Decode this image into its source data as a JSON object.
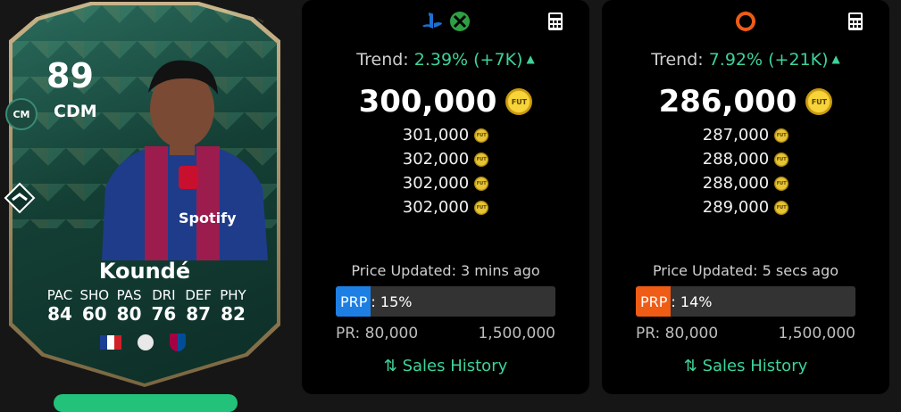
{
  "card": {
    "rating": "89",
    "position": "CDM",
    "alt_position": "CM",
    "name": "Koundé",
    "stats": [
      {
        "label": "PAC",
        "value": "84"
      },
      {
        "label": "SHO",
        "value": "60"
      },
      {
        "label": "PAS",
        "value": "80"
      },
      {
        "label": "DRI",
        "value": "76"
      },
      {
        "label": "DEF",
        "value": "87"
      },
      {
        "label": "PHY",
        "value": "82"
      }
    ],
    "icons": [
      "playstyle-icon",
      "france-flag-icon",
      "league-icon",
      "club-badge-icon"
    ]
  },
  "panels": [
    {
      "platforms": [
        "playstation-icon",
        "xbox-icon"
      ],
      "trend_label": "Trend:",
      "trend_value": "2.39% (+7K)",
      "main_price": "300,000",
      "coin_label": "FUT",
      "prices": [
        "301,000",
        "302,000",
        "302,000",
        "302,000"
      ],
      "updated": "Price Updated: 3 mins ago",
      "prp_label": "PRP",
      "prp_value": ": 15%",
      "prp_percent": 15,
      "pr_min": "PR: 80,000",
      "pr_max": "1,500,000",
      "sales_history": "Sales History",
      "accent": "#1d7fe3"
    },
    {
      "platforms": [
        "origin-icon"
      ],
      "trend_label": "Trend:",
      "trend_value": "7.92% (+21K)",
      "main_price": "286,000",
      "coin_label": "FUT",
      "prices": [
        "287,000",
        "288,000",
        "288,000",
        "289,000"
      ],
      "updated": "Price Updated: 5 secs ago",
      "prp_label": "PRP",
      "prp_value": ": 14%",
      "prp_percent": 14,
      "pr_min": "PR: 80,000",
      "pr_max": "1,500,000",
      "sales_history": "Sales History",
      "accent": "#ee5c16"
    }
  ],
  "colors": {
    "trend_green": "#3ed39a",
    "coin_gold": "#f6d43a"
  }
}
